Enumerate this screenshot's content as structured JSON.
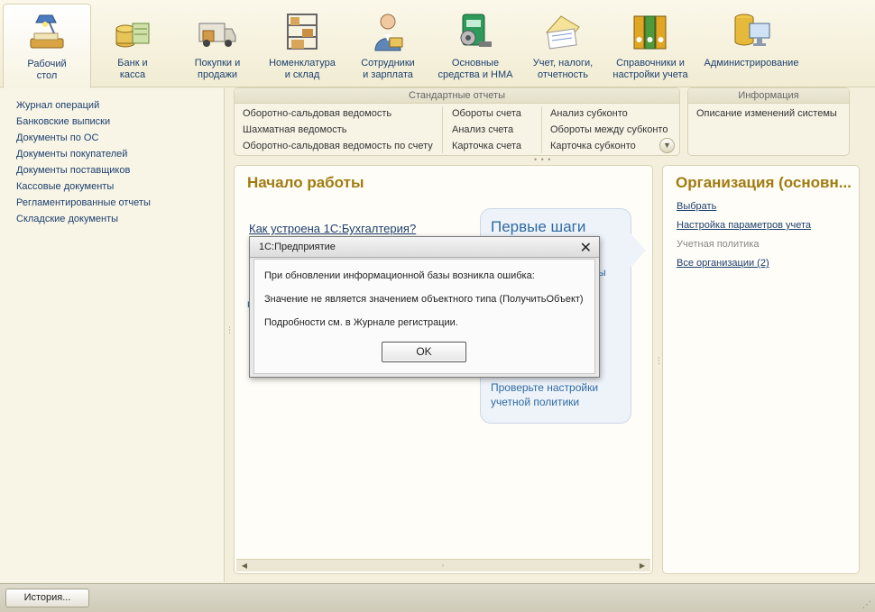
{
  "toolbar": {
    "items": [
      {
        "label": "Рабочий\nстол",
        "icon": "desk-lamp-icon"
      },
      {
        "label": "Банк и\nкасса",
        "icon": "coins-icon"
      },
      {
        "label": "Покупки и\nпродажи",
        "icon": "delivery-van-icon"
      },
      {
        "label": "Номенклатура\nи склад",
        "icon": "warehouse-shelf-icon"
      },
      {
        "label": "Сотрудники\nи зарплата",
        "icon": "employee-icon"
      },
      {
        "label": "Основные\nсредства и НМА",
        "icon": "machinery-icon"
      },
      {
        "label": "Учет, налоги,\nотчетность",
        "icon": "documents-icon"
      },
      {
        "label": "Справочники и\nнастройки учета",
        "icon": "binders-icon"
      },
      {
        "label": "Администрирование",
        "icon": "database-computer-icon"
      }
    ]
  },
  "sidebar": {
    "items": [
      "Журнал операций",
      "Банковские выписки",
      "Документы по ОС",
      "Документы покупателей",
      "Документы поставщиков",
      "Кассовые документы",
      "Регламентированные отчеты",
      "Складские документы"
    ]
  },
  "reports": {
    "title": "Стандартные отчеты",
    "col1": [
      "Оборотно-сальдовая ведомость",
      "Шахматная ведомость",
      "Оборотно-сальдовая ведомость по счету"
    ],
    "col2": [
      "Обороты счета",
      "Анализ счета",
      "Карточка счета"
    ],
    "col3": [
      "Анализ субконто",
      "Обороты между субконто",
      "Карточка субконто"
    ]
  },
  "info": {
    "title": "Информация",
    "link": "Описание изменений системы"
  },
  "start": {
    "title": "Начало работы",
    "howto_link": "Как устроена 1С:Бухгалтерия?",
    "bubble_title": "Первые шаги",
    "bubble_link": "Проверьте настройки\nучетной политики"
  },
  "org": {
    "title": "Организация (основн...",
    "select": "Выбрать",
    "settings": "Настройка параметров учета",
    "policy": "Учетная политика",
    "all": "Все организации (2)"
  },
  "dialog": {
    "title": "1С:Предприятие",
    "line1": "При обновлении информационной базы возникла ошибка:",
    "line2": "Значение не является значением объектного типа (ПолучитьОбъект)",
    "line3": "Подробности см. в Журнале регистрации.",
    "ok": "OK"
  },
  "bottom": {
    "history": "История..."
  },
  "colors": {
    "link": "#1d3f6e",
    "heading": "#a07b10",
    "bubble_text": "#2f6aa3",
    "background": "#f3efdc"
  }
}
